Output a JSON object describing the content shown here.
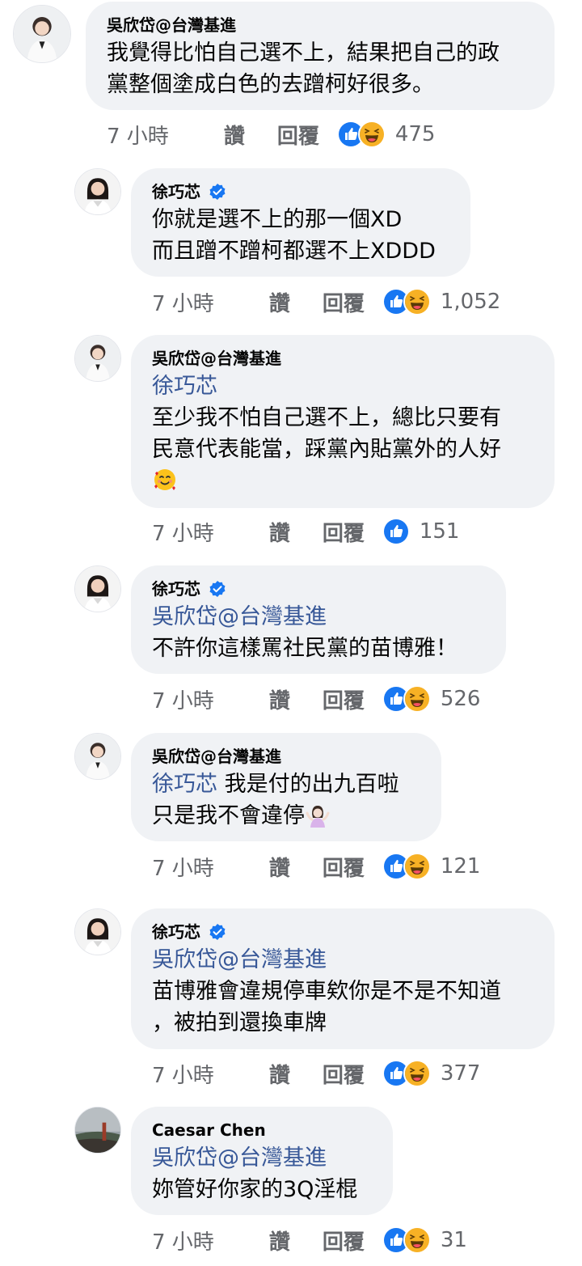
{
  "time_label": "7 小時",
  "like_label": "讚",
  "reply_label": "回覆",
  "comments": [
    {
      "author": "吳欣岱@台灣基進",
      "verified": false,
      "mention": "",
      "line1": "我覺得比怕自己選不上，結果把自己的政",
      "line2": "黨整個塗成白色的去蹭柯好很多。",
      "line3": "",
      "reactions": [
        "like-icon",
        "haha-icon"
      ],
      "count": "475"
    },
    {
      "author": "徐巧芯",
      "verified": true,
      "mention": "",
      "line1": "你就是選不上的那一個XD",
      "line2": "而且蹭不蹭柯都選不上XDDD",
      "line3": "",
      "reactions": [
        "like-icon",
        "haha-icon"
      ],
      "count": "1,052"
    },
    {
      "author": "吳欣岱@台灣基進",
      "verified": false,
      "mention": "徐巧芯",
      "line1": "至少我不怕自己選不上，總比只要有",
      "line2": "民意代表能當，踩黨內貼黨外的人好",
      "line3": "",
      "emoji": "smiling-face-with-hearts-emoji",
      "reactions": [
        "like-icon"
      ],
      "count": "151"
    },
    {
      "author": "徐巧芯",
      "verified": true,
      "mention": "吳欣岱@台灣基進",
      "line1": "不許你這樣罵社民黨的苗博雅！",
      "line2": "",
      "line3": "",
      "reactions": [
        "like-icon",
        "haha-icon"
      ],
      "count": "526"
    },
    {
      "author": "吳欣岱@台灣基進",
      "verified": false,
      "mention": "徐巧芯",
      "line1": " 我是付的出九百啦",
      "line2": "只是我不會違停",
      "line3": "",
      "emoji": "person-shrugging-emoji",
      "reactions": [
        "like-icon",
        "haha-icon"
      ],
      "count": "121"
    },
    {
      "author": "徐巧芯",
      "verified": true,
      "mention": "吳欣岱@台灣基進",
      "line1": "苗博雅會違規停車欸你是不是不知道",
      "line2": "，被拍到還換車牌",
      "line3": "",
      "reactions": [
        "like-icon",
        "haha-icon"
      ],
      "count": "377"
    },
    {
      "author": "Caesar Chen",
      "verified": false,
      "mention": "吳欣岱@台灣基進",
      "line1": "妳管好你家的3Q淫棍",
      "line2": "",
      "line3": "",
      "reactions": [
        "like-icon",
        "haha-icon"
      ],
      "count": "31"
    }
  ],
  "colors": {
    "bubble": "#f0f2f5",
    "mention": "#385898",
    "like_blue": "#1877f2",
    "haha_yellow": "#f7b125",
    "meta_gray": "#65676b"
  }
}
